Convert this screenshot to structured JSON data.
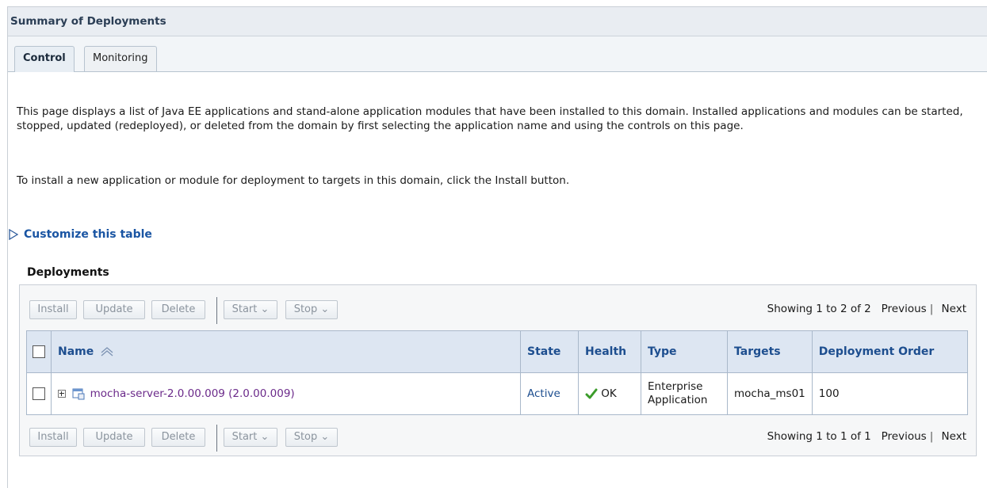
{
  "page": {
    "title": "Summary of Deployments",
    "tabs": [
      {
        "label": "Control"
      },
      {
        "label": "Monitoring"
      }
    ],
    "description": {
      "para1": "This page displays a list of Java EE applications and stand-alone application modules that have been installed to this domain. Installed applications and modules can be started, stopped, updated (redeployed), or deleted from the domain by first selecting the application name and using the controls on this page.",
      "para2": "To install a new application or module for deployment to targets in this domain, click the Install button."
    },
    "customize_link": "Customize this table",
    "section_title": "Deployments"
  },
  "toolbar_top": {
    "install": "Install",
    "update": "Update",
    "delete": "Delete",
    "start": "Start",
    "stop": "Stop",
    "showing": "Showing 1 to 2 of 2",
    "previous": "Previous",
    "next": "Next"
  },
  "toolbar_bottom": {
    "install": "Install",
    "update": "Update",
    "delete": "Delete",
    "start": "Start",
    "stop": "Stop",
    "showing": "Showing 1 to 1 of 1",
    "previous": "Previous",
    "next": "Next"
  },
  "table": {
    "headers": {
      "name": "Name",
      "state": "State",
      "health": "Health",
      "type": "Type",
      "targets": "Targets",
      "order": "Deployment Order"
    },
    "rows": [
      {
        "name": "mocha-server-2.0.00.009 (2.0.00.009)",
        "state": "Active",
        "health": "OK",
        "type_line1": "Enterprise",
        "type_line2": "Application",
        "targets": "mocha_ms01",
        "order": "100"
      }
    ]
  },
  "icons": {
    "customize": "triangle-right-icon",
    "sort": "sort-ascending-icon",
    "expand": "expand-plus-icon",
    "app": "application-icon",
    "health": "checkmark-icon",
    "dropdown": "chevron-down-icon"
  },
  "colors": {
    "link_blue": "#1d4e8f",
    "visited_purple": "#6b2a8a",
    "header_bg": "#dde6f2",
    "ok_green": "#3b9c2a"
  }
}
